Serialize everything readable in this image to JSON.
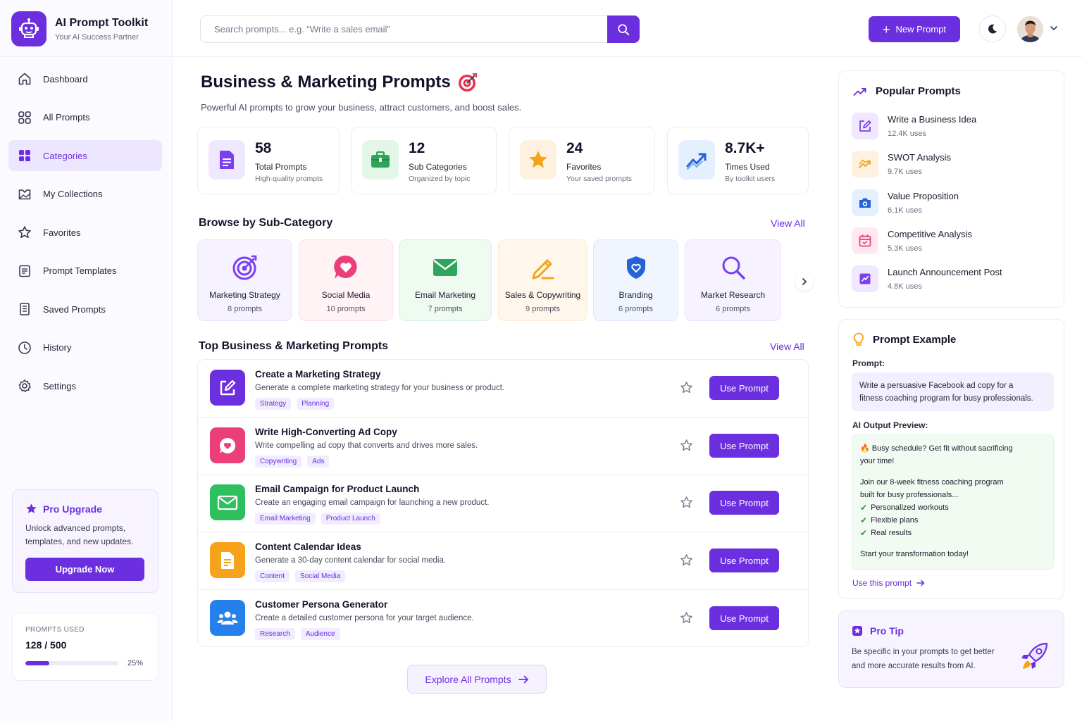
{
  "brand": {
    "title": "AI Prompt Toolkit",
    "subtitle": "Your AI Success Partner"
  },
  "sidebar": {
    "items": [
      {
        "label": "Dashboard",
        "icon": "home-icon"
      },
      {
        "label": "All Prompts",
        "icon": "grid-icon"
      },
      {
        "label": "Categories",
        "icon": "categories-icon",
        "active": true
      },
      {
        "label": "My Collections",
        "icon": "collections-icon"
      },
      {
        "label": "Favorites",
        "icon": "star-icon"
      },
      {
        "label": "Prompt Templates",
        "icon": "template-icon"
      },
      {
        "label": "Saved Prompts",
        "icon": "saved-icon"
      },
      {
        "label": "History",
        "icon": "clock-icon"
      },
      {
        "label": "Settings",
        "icon": "gear-icon"
      }
    ],
    "pro": {
      "title": "Pro Upgrade",
      "desc_line1": "Unlock advanced prompts,",
      "desc_line2": "templates, and new updates.",
      "button": "Upgrade Now"
    },
    "usage": {
      "label": "PROMPTS USED",
      "value": "128 / 500",
      "percent_label": "25%",
      "fraction": 0.256
    }
  },
  "header": {
    "search_placeholder": "Search prompts... e.g. “Write a sales email”",
    "new_prompt": "New Prompt"
  },
  "main": {
    "title": "Business & Marketing Prompts",
    "subtitle": "Powerful AI prompts to grow your business, attract customers, and boost sales.",
    "stats": [
      {
        "value": "58",
        "label": "Total Prompts",
        "sub": "High-quality prompts",
        "icon": "document-icon"
      },
      {
        "value": "12",
        "label": "Sub Categories",
        "sub": "Organized by topic",
        "icon": "briefcase-icon"
      },
      {
        "value": "24",
        "label": "Favorites",
        "sub": "Your saved prompts",
        "icon": "star-icon"
      },
      {
        "value": "8.7K+",
        "label": "Times Used",
        "sub": "By toolkit users",
        "icon": "trend-icon"
      }
    ],
    "browse": {
      "title": "Browse by Sub-Category",
      "view_all": "View All",
      "items": [
        {
          "name": "Marketing Strategy",
          "count": "8 prompts",
          "icon": "target-icon"
        },
        {
          "name": "Social Media",
          "count": "10 prompts",
          "icon": "heart-chat-icon"
        },
        {
          "name": "Email Marketing",
          "count": "7 prompts",
          "icon": "mail-icon"
        },
        {
          "name": "Sales & Copywriting",
          "count": "9 prompts",
          "icon": "pencil-icon"
        },
        {
          "name": "Branding",
          "count": "6 prompts",
          "icon": "shield-icon"
        },
        {
          "name": "Market Research",
          "count": "6 prompts",
          "icon": "magnifier-icon"
        }
      ]
    },
    "top": {
      "title": "Top Business & Marketing Prompts",
      "view_all": "View All",
      "use_label": "Use Prompt",
      "items": [
        {
          "title": "Create a Marketing Strategy",
          "desc": "Generate a complete marketing strategy for your business or product.",
          "tags": [
            "Strategy",
            "Planning"
          ],
          "icon": "edit-icon"
        },
        {
          "title": "Write High-Converting Ad Copy",
          "desc": "Write compelling ad copy that converts and drives more sales.",
          "tags": [
            "Copywriting",
            "Ads"
          ],
          "icon": "heart-chat-icon"
        },
        {
          "title": "Email Campaign for Product Launch",
          "desc": "Create an engaging email campaign for launching a new product.",
          "tags": [
            "Email Marketing",
            "Product Launch"
          ],
          "icon": "mail-icon"
        },
        {
          "title": "Content Calendar Ideas",
          "desc": "Generate a 30-day content calendar for social media.",
          "tags": [
            "Content",
            "Social Media"
          ],
          "icon": "document-icon"
        },
        {
          "title": "Customer Persona Generator",
          "desc": "Create a detailed customer persona for your target audience.",
          "tags": [
            "Research",
            "Audience"
          ],
          "icon": "users-icon"
        }
      ]
    },
    "explore": "Explore All Prompts"
  },
  "popular": {
    "title": "Popular Prompts",
    "items": [
      {
        "name": "Write a Business Idea",
        "uses": "12.4K uses",
        "icon": "edit-icon"
      },
      {
        "name": "SWOT Analysis",
        "uses": "9.7K uses",
        "icon": "chart-icon"
      },
      {
        "name": "Value Proposition",
        "uses": "6.1K uses",
        "icon": "camera-icon"
      },
      {
        "name": "Competitive Analysis",
        "uses": "5.3K uses",
        "icon": "calendar-icon"
      },
      {
        "name": "Launch Announcement Post",
        "uses": "4.8K uses",
        "icon": "check-square-icon"
      }
    ]
  },
  "example": {
    "title": "Prompt Example",
    "prompt_label": "Prompt:",
    "prompt_line1": "Write a persuasive Facebook ad copy for a",
    "prompt_line2": "fitness coaching program for busy professionals.",
    "output_label": "AI Output Preview:",
    "out_line1": "🔥 Busy schedule? Get fit without sacrificing",
    "out_line2": "your time!",
    "out_line3": "Join our 8-week fitness coaching program",
    "out_line4": "built for busy professionals...",
    "checks": [
      "Personalized workouts",
      "Flexible plans",
      "Real results"
    ],
    "out_final": "Start your transformation today!",
    "use_link": "Use this prompt"
  },
  "tip": {
    "title": "Pro Tip",
    "desc_line1": "Be specific in your prompts to get better",
    "desc_line2": "and more accurate results from AI."
  },
  "colors": {
    "accent": "#6b2fe0",
    "accent_light": "#ede6ff"
  }
}
